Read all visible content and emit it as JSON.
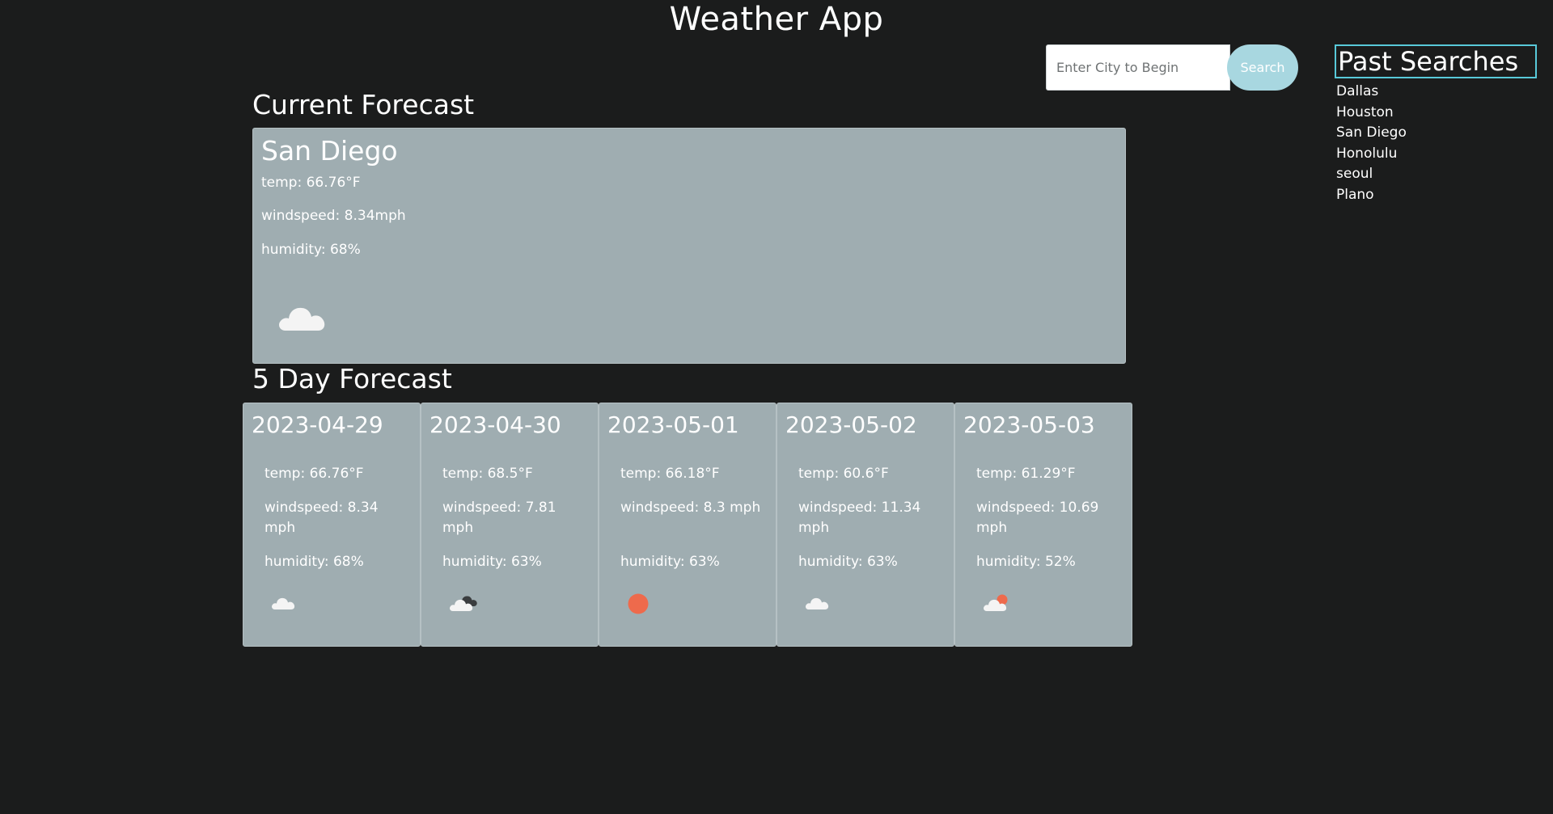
{
  "header": {
    "title": "Weather App"
  },
  "search": {
    "placeholder": "Enter City to Begin",
    "button_label": "Search"
  },
  "past_searches": {
    "title": "Past Searches",
    "items": [
      "Dallas",
      "Houston",
      "San Diego",
      "Honolulu",
      "seoul",
      "Plano"
    ]
  },
  "current": {
    "section_title": "Current Forecast",
    "city": "San Diego",
    "temp": "temp: 66.76°F",
    "windspeed": "windspeed: 8.34mph",
    "humidity": "humidity: 68%",
    "icon": "cloud-icon"
  },
  "forecast": {
    "section_title": "5 Day Forecast",
    "days": [
      {
        "date": "2023-04-29",
        "temp": "temp: 66.76°F",
        "windspeed": "windspeed: 8.34 mph",
        "humidity": "humidity: 68%",
        "icon": "cloud-icon"
      },
      {
        "date": "2023-04-30",
        "temp": "temp: 68.5°F",
        "windspeed": "windspeed: 7.81 mph",
        "humidity": "humidity: 63%",
        "icon": "broken-clouds-icon"
      },
      {
        "date": "2023-05-01",
        "temp": "temp: 66.18°F",
        "windspeed": "windspeed: 8.3 mph",
        "humidity": "humidity: 63%",
        "icon": "sun-icon"
      },
      {
        "date": "2023-05-02",
        "temp": "temp: 60.6°F",
        "windspeed": "windspeed: 11.34 mph",
        "humidity": "humidity: 63%",
        "icon": "cloud-icon"
      },
      {
        "date": "2023-05-03",
        "temp": "temp: 61.29°F",
        "windspeed": "windspeed: 10.69 mph",
        "humidity": "humidity: 52%",
        "icon": "few-clouds-icon"
      }
    ]
  },
  "colors": {
    "background": "#1b1c1c",
    "card": "#9fadb1",
    "accent": "#a8d7e0",
    "past_title_border": "#58c9d9",
    "sun": "#ee6a4c",
    "cloud": "#f4f4f4",
    "dark_cloud": "#3a3d3f"
  }
}
